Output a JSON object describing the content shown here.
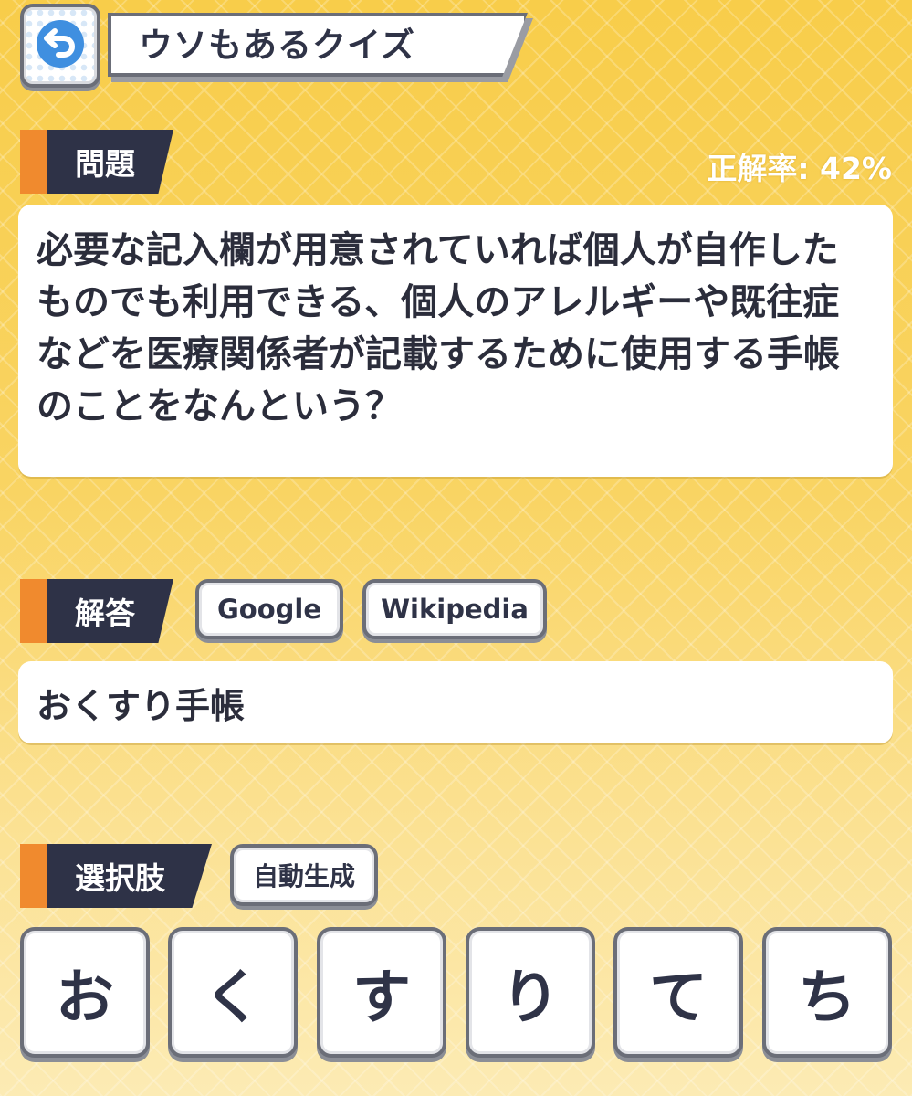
{
  "header": {
    "title": "ウソもあるクイズ",
    "back_icon": "back-arrow-icon"
  },
  "question_section": {
    "label": "問題",
    "accuracy": "正解率: 42%",
    "text": "必要な記入欄が用意されていれば個人が自作したものでも利用できる、個人のアレルギーや既往症などを医療関係者が記載するために使用する手帳のことをなんという？"
  },
  "answer_section": {
    "label": "解答",
    "google_button": "Google",
    "wikipedia_button": "Wikipedia",
    "answer": "おくすり手帳"
  },
  "choices_section": {
    "label": "選択肢",
    "auto_generate_button": "自動生成",
    "choices": [
      "お",
      "く",
      "す",
      "り",
      "て",
      "ち"
    ]
  },
  "colors": {
    "accent": "#f08a2e",
    "label_bg": "#2e3247",
    "background": "#f9d463"
  }
}
